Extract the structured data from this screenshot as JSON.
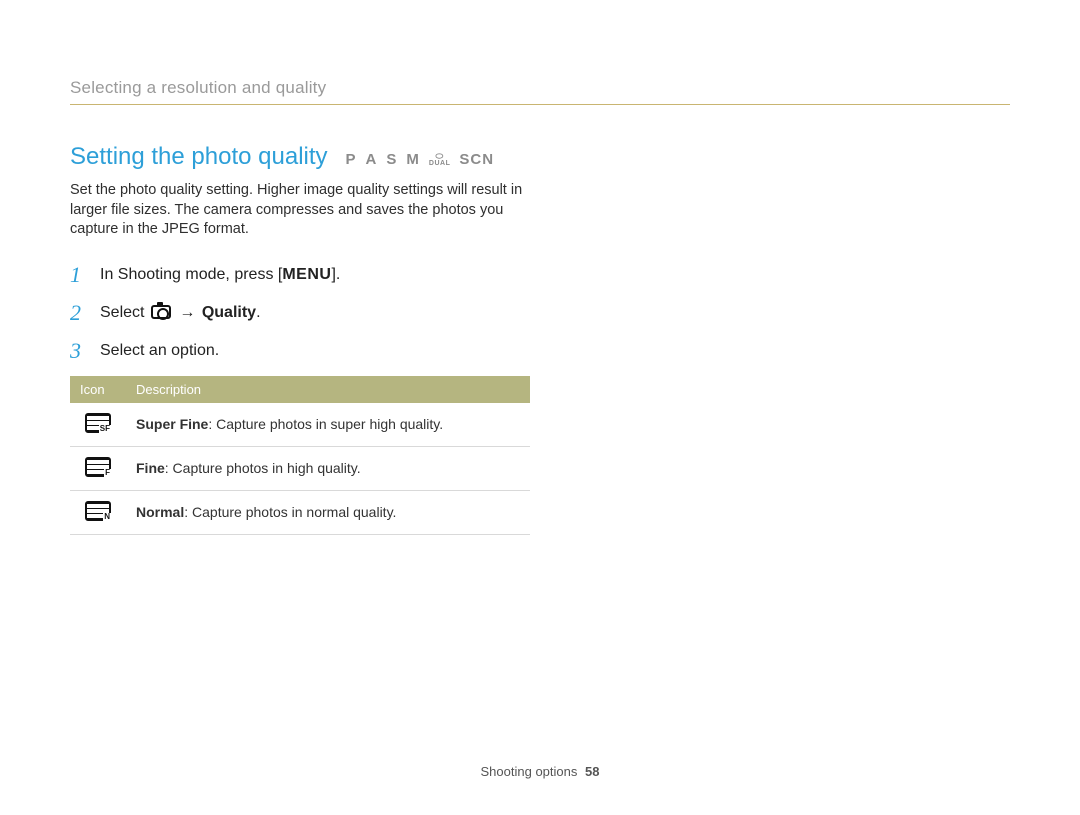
{
  "breadcrumb": "Selecting a resolution and quality",
  "heading": "Setting the photo quality",
  "mode_labels": {
    "p": "P",
    "a": "A",
    "s": "S",
    "m": "M",
    "dual": "DUAL",
    "scn": "SCN"
  },
  "intro": "Set the photo quality setting. Higher image quality settings will result in larger file sizes. The camera compresses and saves the photos you capture in the JPEG format.",
  "steps": {
    "s1_prefix": "In Shooting mode, press [",
    "s1_menu": "MENU",
    "s1_suffix": "].",
    "s2_prefix": "Select ",
    "s2_arrow": "→",
    "s2_bold": "Quality",
    "s2_suffix": ".",
    "s3": "Select an option."
  },
  "table": {
    "header_icon": "Icon",
    "header_desc": "Description",
    "rows": [
      {
        "sub": "SF",
        "name": "Super Fine",
        "desc": ": Capture photos in super high quality."
      },
      {
        "sub": "F",
        "name": "Fine",
        "desc": ": Capture photos in high quality."
      },
      {
        "sub": "N",
        "name": "Normal",
        "desc": ": Capture photos in normal quality."
      }
    ]
  },
  "footer": {
    "section": "Shooting options",
    "page": "58"
  }
}
